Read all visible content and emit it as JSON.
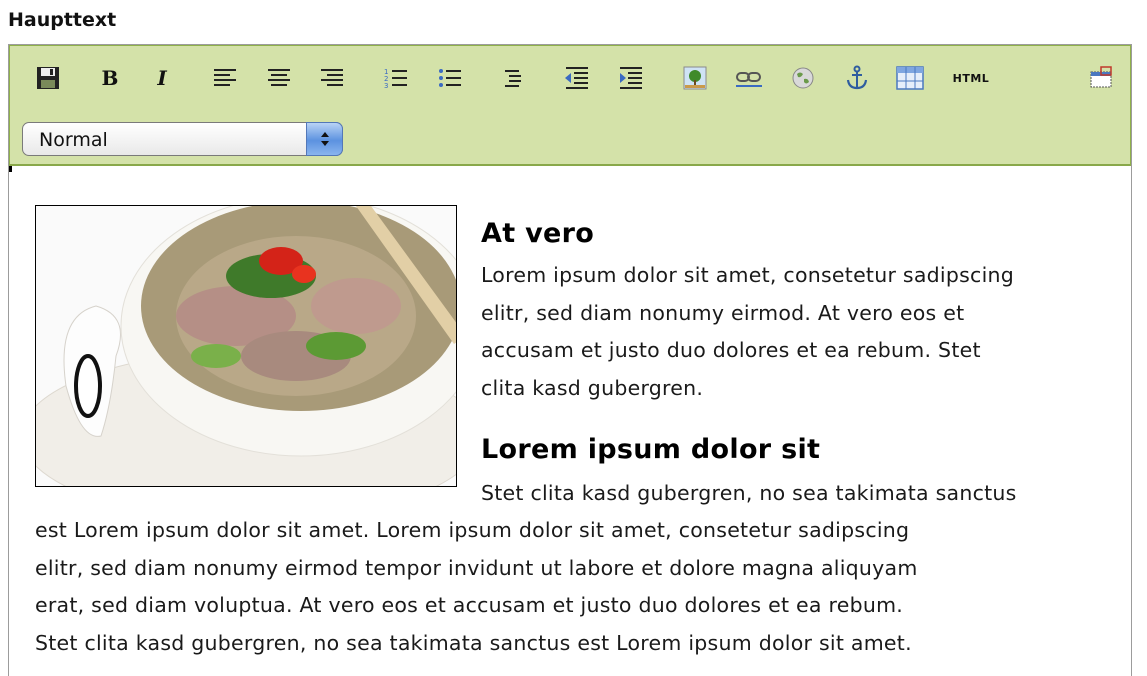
{
  "field": {
    "label": "Haupttext"
  },
  "toolbar": {
    "buttons": [
      {
        "id": "save",
        "icon": "floppy-disk-icon",
        "label": ""
      },
      {
        "id": "bold",
        "icon": "bold-icon",
        "label": "B"
      },
      {
        "id": "italic",
        "icon": "italic-icon",
        "label": "I"
      },
      {
        "id": "align-left",
        "icon": "align-left-icon",
        "label": ""
      },
      {
        "id": "align-center",
        "icon": "align-center-icon",
        "label": ""
      },
      {
        "id": "align-right",
        "icon": "align-right-icon",
        "label": ""
      },
      {
        "id": "ordered-list",
        "icon": "ordered-list-icon",
        "label": ""
      },
      {
        "id": "unordered-list",
        "icon": "unordered-list-icon",
        "label": ""
      },
      {
        "id": "indent-list",
        "icon": "list-indent-icon",
        "label": ""
      },
      {
        "id": "outdent",
        "icon": "outdent-icon",
        "label": ""
      },
      {
        "id": "indent",
        "icon": "indent-icon",
        "label": ""
      },
      {
        "id": "image",
        "icon": "insert-image-icon",
        "label": ""
      },
      {
        "id": "link",
        "icon": "link-icon",
        "label": ""
      },
      {
        "id": "web",
        "icon": "globe-icon",
        "label": ""
      },
      {
        "id": "anchor",
        "icon": "anchor-icon",
        "label": ""
      },
      {
        "id": "table",
        "icon": "table-icon",
        "label": ""
      },
      {
        "id": "html",
        "icon": "html-source-icon",
        "label": "HTML"
      },
      {
        "id": "maximize",
        "icon": "maximize-icon",
        "label": ""
      }
    ],
    "paragraph_style": {
      "value": "Normal"
    }
  },
  "content": {
    "heading1": "At vero",
    "para1_lines": [
      "Lorem ipsum dolor sit amet, consetetur sadipscing",
      "elitr, sed diam nonumy eirmod. At vero eos et",
      "accusam et justo duo dolores et ea rebum. Stet",
      "clita kasd gubergren."
    ],
    "heading2": "Lorem ipsum dolor sit",
    "para2_lines": [
      "Stet clita kasd gubergren, no sea takimata sanctus",
      "est Lorem ipsum dolor sit amet. Lorem ipsum dolor sit amet, consetetur sadipscing",
      "elitr, sed diam nonumy eirmod tempor invidunt ut labore et dolore magna aliquyam",
      "erat, sed diam voluptua. At vero eos et accusam et justo duo dolores et ea rebum.",
      "Stet clita kasd gubergren, no sea takimata sanctus est Lorem ipsum dolor sit amet."
    ]
  },
  "colors": {
    "toolbar_bg": "#d4e2a9",
    "toolbar_border": "#8fb04a",
    "select_stepper": "#5c92e0"
  }
}
